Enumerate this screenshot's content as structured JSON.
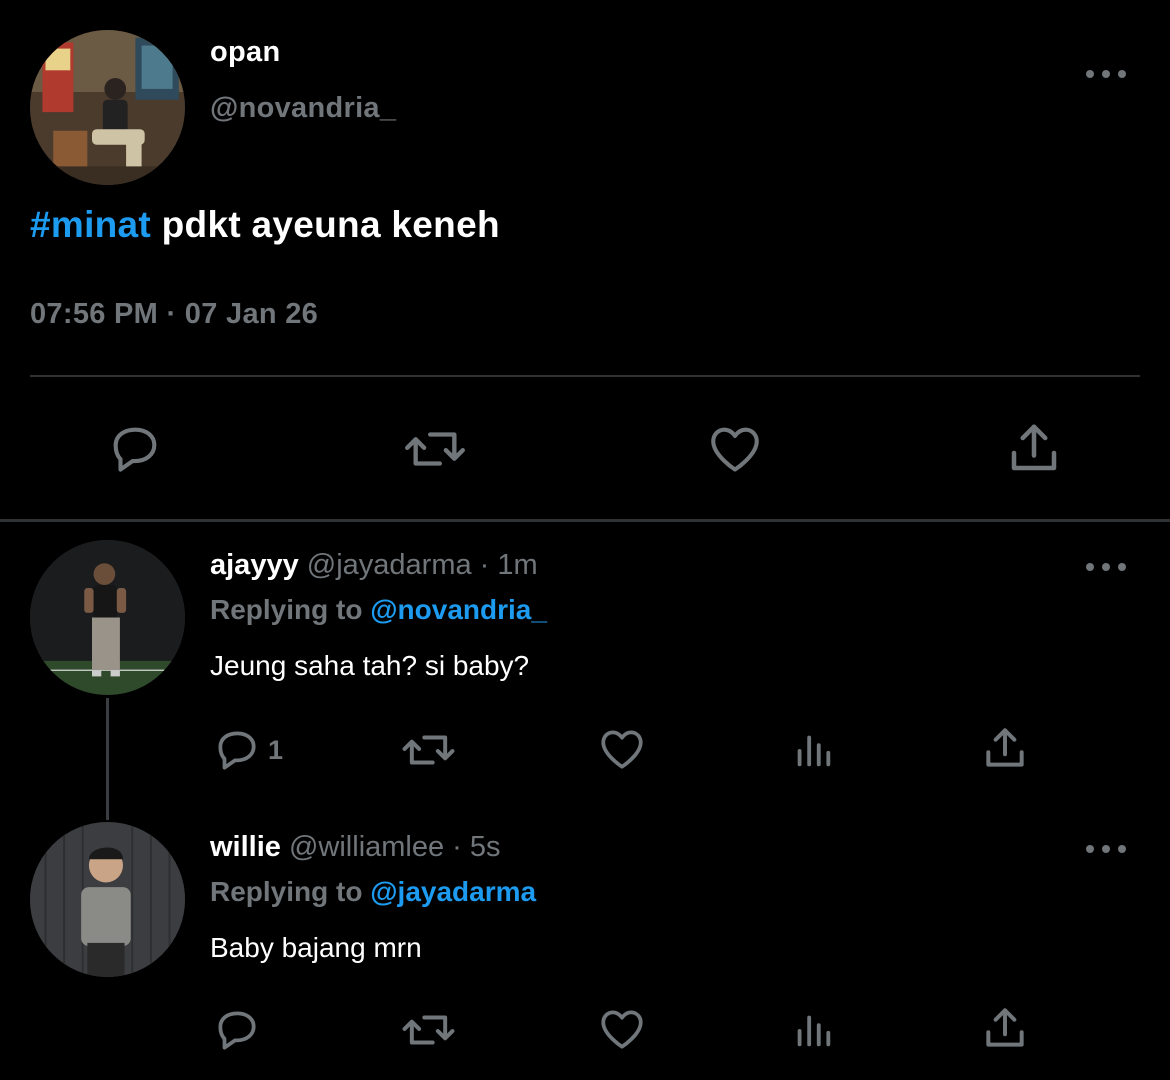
{
  "main_tweet": {
    "name": "opan",
    "handle": "@novandria_",
    "hashtag": "#minat",
    "text": " pdkt ayeuna keneh",
    "timestamp": "07:56 PM · 07 Jan 26"
  },
  "replies": [
    {
      "name": "ajayyy",
      "handle": "@jayadarma",
      "sep": " · ",
      "time": "1m",
      "replying_prefix": "Replying to ",
      "replying_to": "@novandria_",
      "text": "Jeung saha tah? si baby?",
      "reply_count": "1"
    },
    {
      "name": "willie",
      "handle": "@williamlee",
      "sep": " · ",
      "time": "5s",
      "replying_prefix": "Replying to ",
      "replying_to": "@jayadarma",
      "text": "Baby bajang mrn",
      "reply_count": ""
    }
  ],
  "icons": {
    "reply": "reply-icon",
    "retweet": "retweet-icon",
    "like": "heart-icon",
    "views": "views-icon",
    "share": "share-icon",
    "more": "more-icon"
  },
  "colors": {
    "background": "#000000",
    "text": "#ffffff",
    "muted": "#71767b",
    "accent": "#1d9bf0",
    "divider": "#2f3336"
  }
}
